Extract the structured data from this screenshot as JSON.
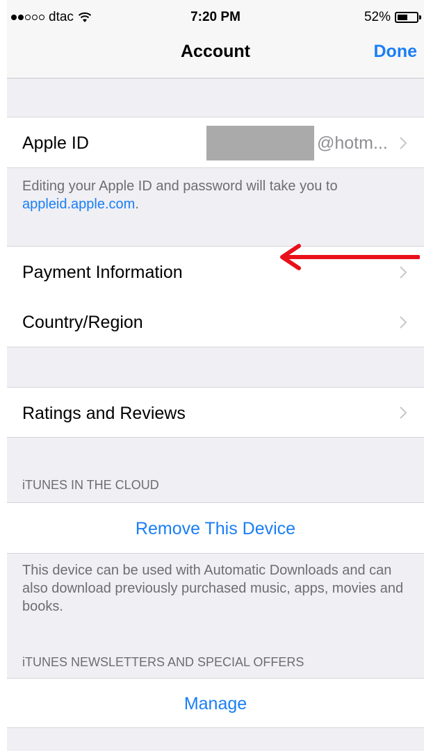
{
  "status_bar": {
    "carrier": "dtac",
    "time": "7:20 PM",
    "battery": "52%",
    "battery_level": 0.52,
    "signal_bars_filled": 2,
    "signal_bars_total": 5
  },
  "nav": {
    "title": "Account",
    "done_label": "Done"
  },
  "apple_id": {
    "label": "Apple ID",
    "value": "@hotm..."
  },
  "apple_id_footer": {
    "text": "Editing your Apple ID and password will take you to",
    "link": "appleid.apple.com",
    "suffix": "."
  },
  "payment": {
    "label": "Payment Information"
  },
  "country": {
    "label": "Country/Region"
  },
  "ratings": {
    "label": "Ratings and Reviews"
  },
  "itunes_cloud": {
    "header": "iTUNES IN THE CLOUD",
    "action": "Remove This Device",
    "footer": "This device can be used with Automatic Downloads and can also download previously purchased music, apps, movies and books."
  },
  "newsletters": {
    "header": "iTUNES NEWSLETTERS AND SPECIAL OFFERS",
    "action": "Manage"
  },
  "colors": {
    "accent": "#1a7ef5",
    "annotation_arrow": "#e8101a",
    "group_background": "#efeff4"
  }
}
